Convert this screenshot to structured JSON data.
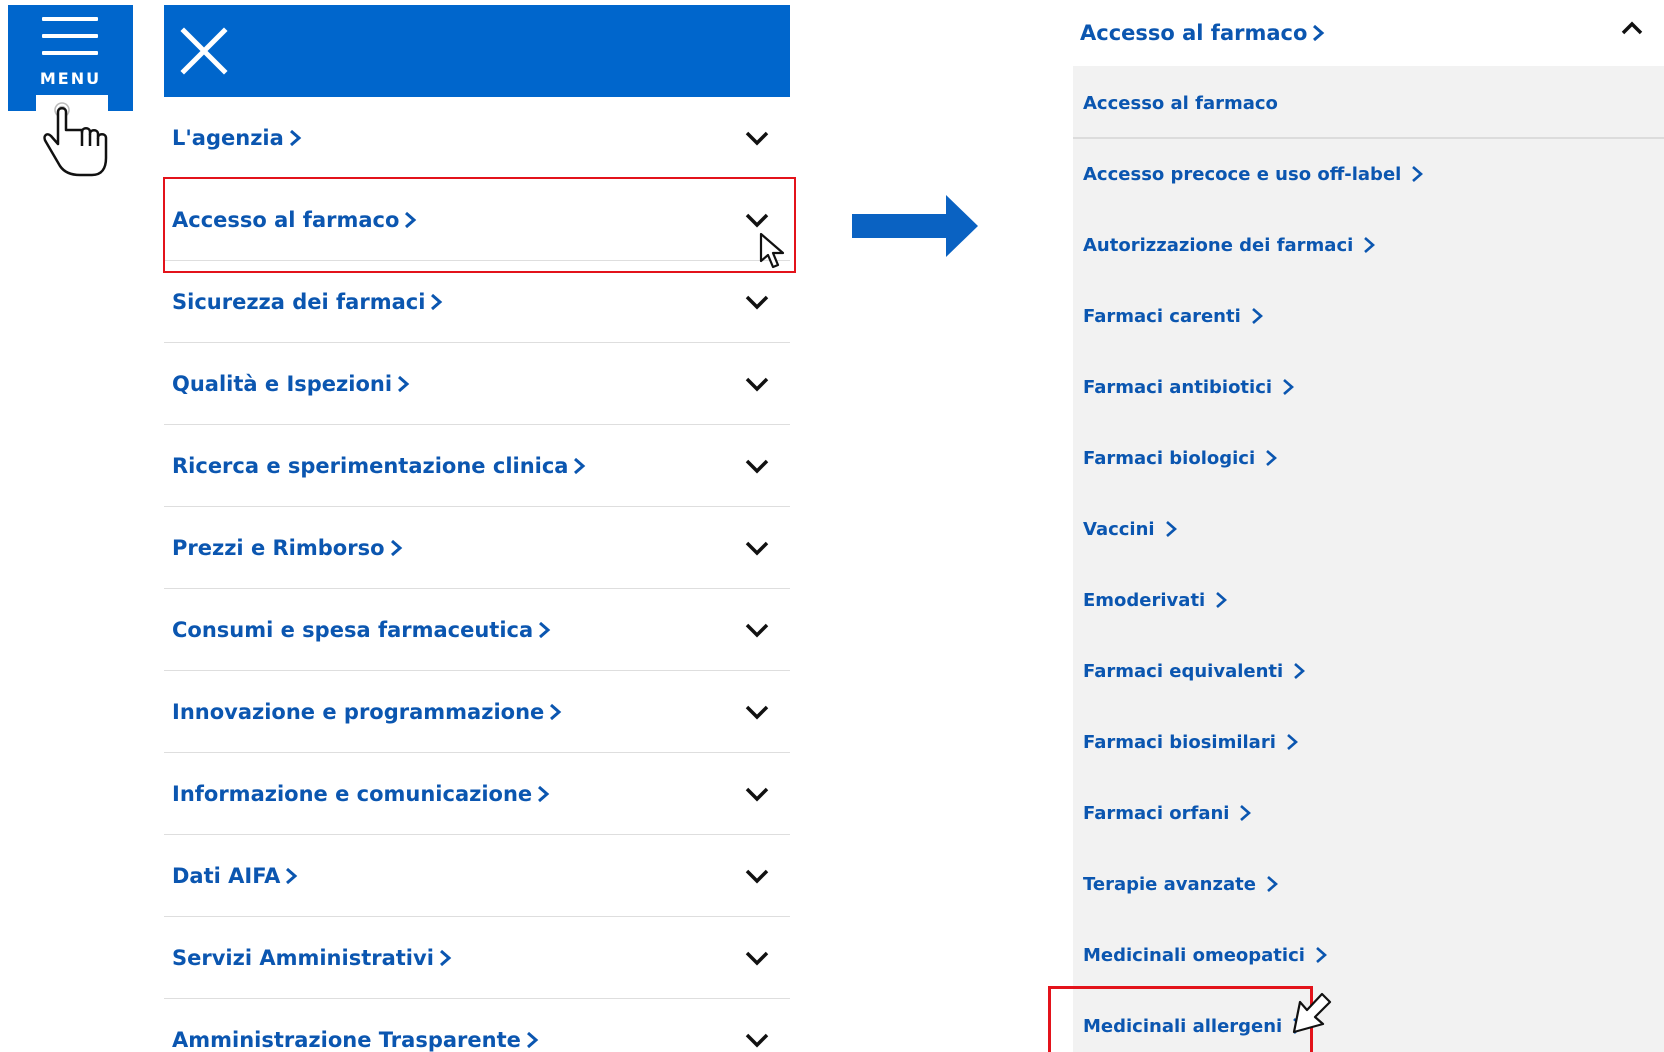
{
  "menu_button": {
    "label": "MENU"
  },
  "nav": {
    "items": [
      {
        "label": "L'agenzia"
      },
      {
        "label": "Accesso al farmaco"
      },
      {
        "label": "Sicurezza dei farmaci"
      },
      {
        "label": "Qualità e Ispezioni"
      },
      {
        "label": "Ricerca e sperimentazione clinica"
      },
      {
        "label": "Prezzi e Rimborso"
      },
      {
        "label": "Consumi e spesa farmaceutica"
      },
      {
        "label": "Innovazione e programmazione"
      },
      {
        "label": "Informazione e comunicazione"
      },
      {
        "label": "Dati AIFA"
      },
      {
        "label": "Servizi Amministrativi"
      },
      {
        "label": "Amministrazione Trasparente"
      }
    ]
  },
  "submenu": {
    "header": "Accesso al farmaco",
    "items": [
      {
        "label": "Accesso al farmaco"
      },
      {
        "label": "Accesso precoce e uso off-label"
      },
      {
        "label": "Autorizzazione dei farmaci"
      },
      {
        "label": "Farmaci carenti"
      },
      {
        "label": "Farmaci antibiotici"
      },
      {
        "label": "Farmaci biologici"
      },
      {
        "label": "Vaccini"
      },
      {
        "label": "Emoderivati"
      },
      {
        "label": "Farmaci equivalenti"
      },
      {
        "label": "Farmaci biosimilari"
      },
      {
        "label": "Farmaci orfani"
      },
      {
        "label": "Terapie avanzate"
      },
      {
        "label": "Medicinali omeopatici"
      },
      {
        "label": "Medicinali allergeni"
      }
    ]
  },
  "colors": {
    "brand_blue": "#0066cc",
    "link_blue": "#0b56b0",
    "highlight_red": "#e3131b",
    "submenu_bg": "#f2f2f2"
  },
  "icons": {
    "menu": "hamburger-icon",
    "close": "close-icon",
    "expand": "chevron-down-icon",
    "collapse": "chevron-up-icon",
    "link": "chevron-right-icon",
    "pointer": "hand-pointer-icon",
    "cursor": "arrow-cursor-icon",
    "transition": "right-arrow-icon"
  }
}
